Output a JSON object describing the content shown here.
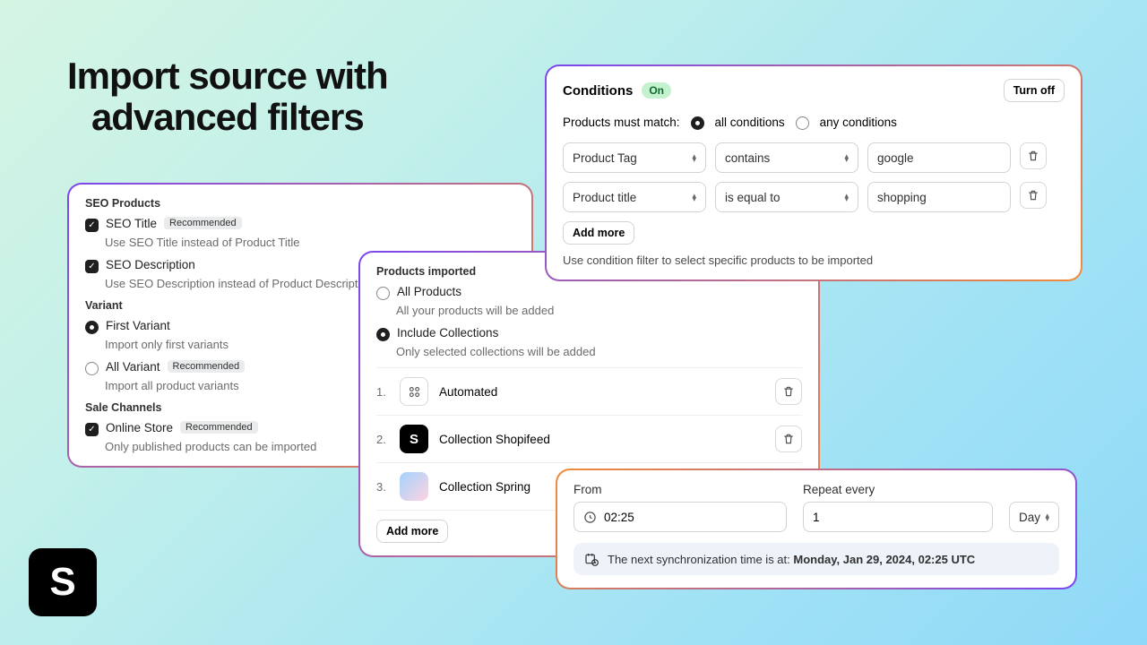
{
  "heading_line1": "Import source with",
  "heading_line2": "advanced filters",
  "tag_recommended": "Recommended",
  "seo_panel": {
    "section1": "SEO Products",
    "seo_title": "SEO Title",
    "seo_title_desc": "Use SEO Title instead of Product Title",
    "seo_desc": "SEO Description",
    "seo_desc_desc": "Use SEO Description instead of Product Description",
    "section2": "Variant",
    "first_variant": "First Variant",
    "first_variant_desc": "Import only first variants",
    "all_variant": "All Variant",
    "all_variant_desc": "Import all product variants",
    "section3": "Sale Channels",
    "online_store": "Online Store",
    "online_store_desc": "Only published products can be imported"
  },
  "imports": {
    "title": "Products imported",
    "all": "All Products",
    "all_desc": "All your products will be added",
    "collections": "Include Collections",
    "collections_desc": "Only selected collections will be added",
    "items": [
      {
        "n": "1.",
        "name": "Automated",
        "thumb": "auto"
      },
      {
        "n": "2.",
        "name": "Collection Shopifeed",
        "thumb": "s"
      },
      {
        "n": "3.",
        "name": "Collection Spring",
        "thumb": "spring"
      }
    ],
    "add_more": "Add more"
  },
  "conditions": {
    "title": "Conditions",
    "on": "On",
    "turn_off": "Turn off",
    "match_label": "Products must match:",
    "opt_all": "all conditions",
    "opt_any": "any conditions",
    "rules": [
      {
        "field": "Product Tag",
        "op": "contains",
        "val": "google"
      },
      {
        "field": "Product title",
        "op": "is equal to",
        "val": "shopping"
      }
    ],
    "add_more": "Add more",
    "hint": "Use condition filter to select specific products to be imported"
  },
  "schedule": {
    "from": "From",
    "from_val": "02:25",
    "repeat": "Repeat every",
    "repeat_val": "1",
    "unit": "Day",
    "alert_prefix": "The next synchronization time is at: ",
    "alert_time": "Monday, Jan 29, 2024, 02:25 UTC"
  }
}
